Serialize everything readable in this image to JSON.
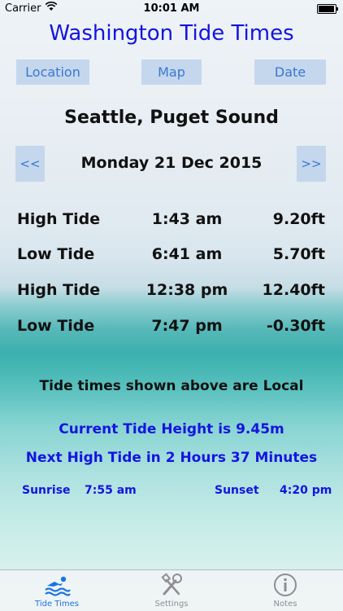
{
  "status_bar": {
    "carrier": "Carrier",
    "time": "10:01 AM",
    "battery_level": 0.95
  },
  "app_title": "Washington Tide Times",
  "nav_buttons": {
    "location": "Location",
    "map": "Map",
    "date": "Date"
  },
  "location": "Seattle, Puget Sound",
  "date_nav": {
    "prev": "<<",
    "date": "Monday 21 Dec 2015",
    "next": ">>"
  },
  "tides": [
    {
      "type": "High Tide",
      "time": "1:43 am",
      "height": "9.20ft"
    },
    {
      "type": "Low Tide",
      "time": "6:41 am",
      "height": "5.70ft"
    },
    {
      "type": "High Tide",
      "time": "12:38 pm",
      "height": "12.40ft"
    },
    {
      "type": "Low Tide",
      "time": "7:47 pm",
      "height": "-0.30ft"
    }
  ],
  "local_note": "Tide times shown above are Local",
  "current_tide": "Current Tide Height is 9.45m",
  "next_tide": "Next High Tide in 2 Hours 37 Minutes",
  "sun": {
    "sunrise_label": "Sunrise",
    "sunrise_time": "7:55 am",
    "sunset_label": "Sunset",
    "sunset_time": "4:20 pm"
  },
  "tabs": [
    {
      "label": "Tide Times",
      "icon": "swimmer-icon",
      "selected": true
    },
    {
      "label": "Settings",
      "icon": "tools-icon",
      "selected": false
    },
    {
      "label": "Notes",
      "icon": "info-icon",
      "selected": false
    }
  ],
  "colors": {
    "title_blue": "#1414e0",
    "button_bg": "#bed2eb",
    "button_text": "#3a78d0",
    "tab_active": "#1a73e8",
    "tab_inactive": "#8e8e93"
  }
}
